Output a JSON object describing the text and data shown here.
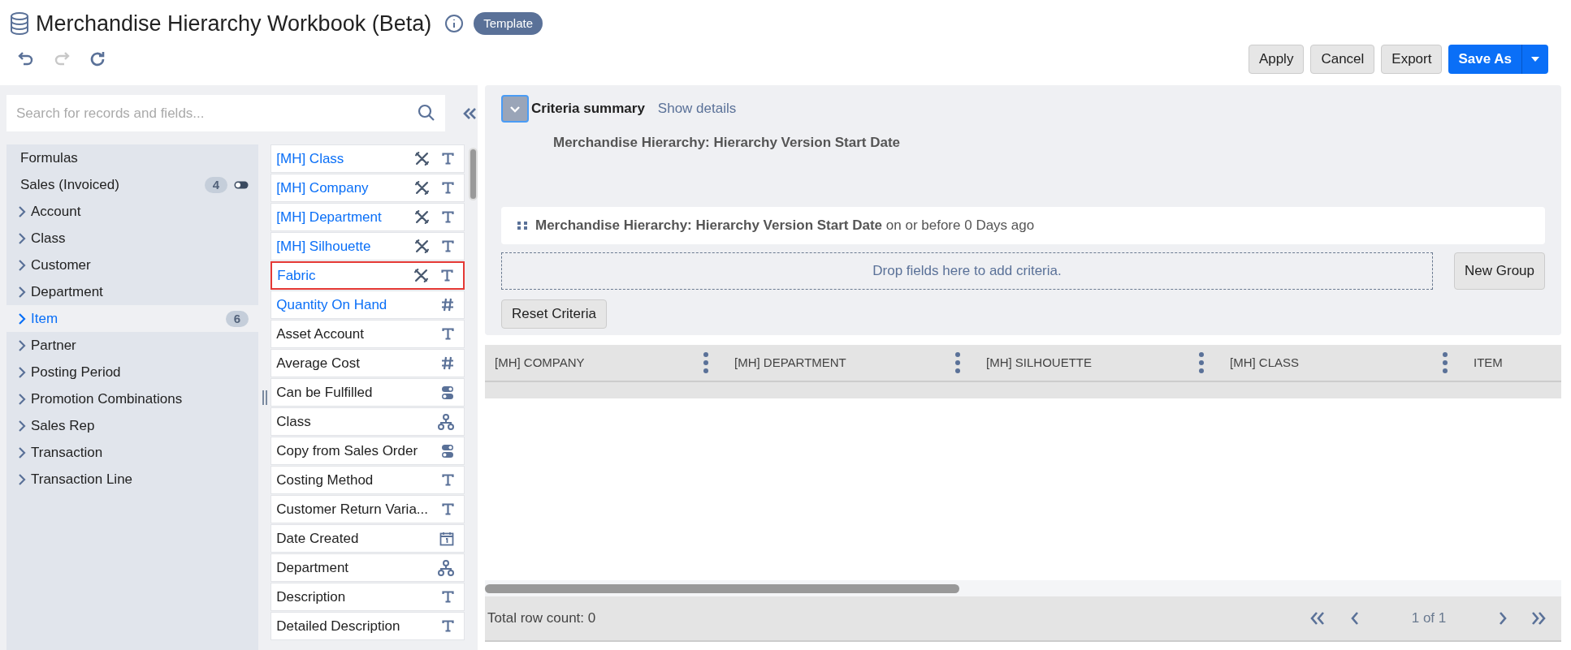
{
  "header": {
    "title": "Merchandise Hierarchy Workbook (Beta)",
    "badge": "Template"
  },
  "toolbar": {
    "undo_disabled": false,
    "redo_disabled": true,
    "buttons": [
      {
        "label": "Apply",
        "kind": "default"
      },
      {
        "label": "Cancel",
        "kind": "default"
      },
      {
        "label": "Export",
        "kind": "default"
      },
      {
        "label": "Save As",
        "kind": "split"
      }
    ]
  },
  "search": {
    "placeholder": "Search for records and fields..."
  },
  "records": [
    {
      "label": "Formulas",
      "kind": "plain",
      "selected": false
    },
    {
      "label": "Sales (Invoiced)",
      "kind": "plain",
      "count": "4",
      "toggle": true,
      "selected": false
    },
    {
      "label": "Account",
      "kind": "record",
      "selected": false
    },
    {
      "label": "Class",
      "kind": "record",
      "selected": false
    },
    {
      "label": "Customer",
      "kind": "record",
      "selected": false
    },
    {
      "label": "Department",
      "kind": "record",
      "selected": false
    },
    {
      "label": "Item",
      "kind": "record",
      "count": "6",
      "selected": true
    },
    {
      "label": "Partner",
      "kind": "record",
      "selected": false
    },
    {
      "label": "Posting Period",
      "kind": "record",
      "selected": false
    },
    {
      "label": "Promotion Combinations",
      "kind": "record",
      "selected": false
    },
    {
      "label": "Sales Rep",
      "kind": "record",
      "selected": false
    },
    {
      "label": "Transaction",
      "kind": "record",
      "selected": false
    },
    {
      "label": "Transaction Line",
      "kind": "record",
      "selected": false
    }
  ],
  "fields": [
    {
      "label": "[MH] Class",
      "kind": "formula",
      "used": true,
      "selected": false
    },
    {
      "label": "[MH] Company",
      "kind": "formula",
      "used": true,
      "selected": false
    },
    {
      "label": "[MH] Department",
      "kind": "formula",
      "used": true,
      "selected": false
    },
    {
      "label": "[MH] Silhouette",
      "kind": "formula",
      "used": true,
      "selected": false
    },
    {
      "label": "Fabric",
      "kind": "formula",
      "used": true,
      "selected": true
    },
    {
      "label": "Quantity On Hand",
      "kind": "number",
      "used": true,
      "selected": false
    },
    {
      "label": "Asset Account",
      "kind": "text",
      "used": false,
      "selected": false
    },
    {
      "label": "Average Cost",
      "kind": "number",
      "used": false,
      "selected": false
    },
    {
      "label": "Can be Fulfilled",
      "kind": "boolean",
      "used": false,
      "selected": false
    },
    {
      "label": "Class",
      "kind": "hierarchy",
      "used": false,
      "selected": false
    },
    {
      "label": "Copy from Sales Order",
      "kind": "boolean",
      "used": false,
      "selected": false
    },
    {
      "label": "Costing Method",
      "kind": "text",
      "used": false,
      "selected": false
    },
    {
      "label": "Customer Return Varia...",
      "kind": "text",
      "used": false,
      "selected": false
    },
    {
      "label": "Date Created",
      "kind": "date",
      "used": false,
      "selected": false
    },
    {
      "label": "Department",
      "kind": "hierarchy",
      "used": false,
      "selected": false
    },
    {
      "label": "Description",
      "kind": "text",
      "used": false,
      "selected": false
    },
    {
      "label": "Detailed Description",
      "kind": "text",
      "used": false,
      "selected": false
    }
  ],
  "criteria": {
    "expanded": true,
    "title": "Criteria summary",
    "link": "Show details",
    "summary": "Merchandise Hierarchy: Hierarchy Version Start Date",
    "conditions": [
      {
        "field": "Merchandise Hierarchy: Hierarchy Version Start Date",
        "rule": "on or before 0 Days ago"
      }
    ],
    "drop_hint": "Drop fields here to add criteria.",
    "new_group": "New Group",
    "reset": "Reset Criteria"
  },
  "table": {
    "columns": [
      "[MH] COMPANY",
      "[MH] DEPARTMENT",
      "[MH] SILHOUETTE",
      "[MH] CLASS",
      "ITEM"
    ]
  },
  "footer": {
    "row_count": "Total row count: 0",
    "page": "1 of 1"
  }
}
